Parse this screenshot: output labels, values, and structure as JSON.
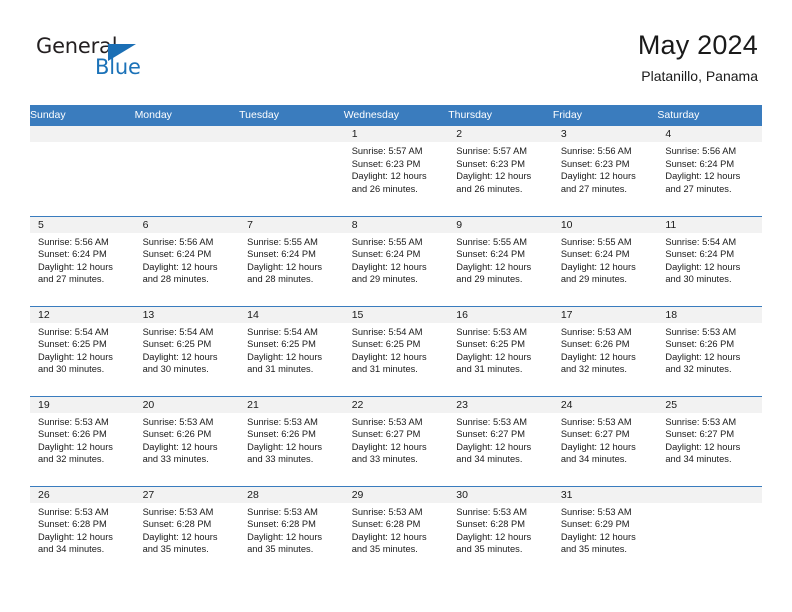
{
  "brand": {
    "name_part1": "General",
    "name_part2": "Blue",
    "logo_icon": "triangle-logo-icon"
  },
  "header": {
    "title": "May 2024",
    "location": "Platanillo, Panama"
  },
  "colors": {
    "header_blue": "#3a7cbe",
    "brand_blue": "#1b72b8",
    "day_strip_grey": "#f2f2f2",
    "text": "#1a1a1a"
  },
  "weekday_headers": [
    "Sunday",
    "Monday",
    "Tuesday",
    "Wednesday",
    "Thursday",
    "Friday",
    "Saturday"
  ],
  "weeks": [
    [
      {
        "day": "",
        "empty": true,
        "sunrise": "",
        "sunset": "",
        "daylight1": "",
        "daylight2": ""
      },
      {
        "day": "",
        "empty": true,
        "sunrise": "",
        "sunset": "",
        "daylight1": "",
        "daylight2": ""
      },
      {
        "day": "",
        "empty": true,
        "sunrise": "",
        "sunset": "",
        "daylight1": "",
        "daylight2": ""
      },
      {
        "day": "1",
        "empty": false,
        "sunrise": "Sunrise: 5:57 AM",
        "sunset": "Sunset: 6:23 PM",
        "daylight1": "Daylight: 12 hours",
        "daylight2": "and 26 minutes."
      },
      {
        "day": "2",
        "empty": false,
        "sunrise": "Sunrise: 5:57 AM",
        "sunset": "Sunset: 6:23 PM",
        "daylight1": "Daylight: 12 hours",
        "daylight2": "and 26 minutes."
      },
      {
        "day": "3",
        "empty": false,
        "sunrise": "Sunrise: 5:56 AM",
        "sunset": "Sunset: 6:23 PM",
        "daylight1": "Daylight: 12 hours",
        "daylight2": "and 27 minutes."
      },
      {
        "day": "4",
        "empty": false,
        "sunrise": "Sunrise: 5:56 AM",
        "sunset": "Sunset: 6:24 PM",
        "daylight1": "Daylight: 12 hours",
        "daylight2": "and 27 minutes."
      }
    ],
    [
      {
        "day": "5",
        "empty": false,
        "sunrise": "Sunrise: 5:56 AM",
        "sunset": "Sunset: 6:24 PM",
        "daylight1": "Daylight: 12 hours",
        "daylight2": "and 27 minutes."
      },
      {
        "day": "6",
        "empty": false,
        "sunrise": "Sunrise: 5:56 AM",
        "sunset": "Sunset: 6:24 PM",
        "daylight1": "Daylight: 12 hours",
        "daylight2": "and 28 minutes."
      },
      {
        "day": "7",
        "empty": false,
        "sunrise": "Sunrise: 5:55 AM",
        "sunset": "Sunset: 6:24 PM",
        "daylight1": "Daylight: 12 hours",
        "daylight2": "and 28 minutes."
      },
      {
        "day": "8",
        "empty": false,
        "sunrise": "Sunrise: 5:55 AM",
        "sunset": "Sunset: 6:24 PM",
        "daylight1": "Daylight: 12 hours",
        "daylight2": "and 29 minutes."
      },
      {
        "day": "9",
        "empty": false,
        "sunrise": "Sunrise: 5:55 AM",
        "sunset": "Sunset: 6:24 PM",
        "daylight1": "Daylight: 12 hours",
        "daylight2": "and 29 minutes."
      },
      {
        "day": "10",
        "empty": false,
        "sunrise": "Sunrise: 5:55 AM",
        "sunset": "Sunset: 6:24 PM",
        "daylight1": "Daylight: 12 hours",
        "daylight2": "and 29 minutes."
      },
      {
        "day": "11",
        "empty": false,
        "sunrise": "Sunrise: 5:54 AM",
        "sunset": "Sunset: 6:24 PM",
        "daylight1": "Daylight: 12 hours",
        "daylight2": "and 30 minutes."
      }
    ],
    [
      {
        "day": "12",
        "empty": false,
        "sunrise": "Sunrise: 5:54 AM",
        "sunset": "Sunset: 6:25 PM",
        "daylight1": "Daylight: 12 hours",
        "daylight2": "and 30 minutes."
      },
      {
        "day": "13",
        "empty": false,
        "sunrise": "Sunrise: 5:54 AM",
        "sunset": "Sunset: 6:25 PM",
        "daylight1": "Daylight: 12 hours",
        "daylight2": "and 30 minutes."
      },
      {
        "day": "14",
        "empty": false,
        "sunrise": "Sunrise: 5:54 AM",
        "sunset": "Sunset: 6:25 PM",
        "daylight1": "Daylight: 12 hours",
        "daylight2": "and 31 minutes."
      },
      {
        "day": "15",
        "empty": false,
        "sunrise": "Sunrise: 5:54 AM",
        "sunset": "Sunset: 6:25 PM",
        "daylight1": "Daylight: 12 hours",
        "daylight2": "and 31 minutes."
      },
      {
        "day": "16",
        "empty": false,
        "sunrise": "Sunrise: 5:53 AM",
        "sunset": "Sunset: 6:25 PM",
        "daylight1": "Daylight: 12 hours",
        "daylight2": "and 31 minutes."
      },
      {
        "day": "17",
        "empty": false,
        "sunrise": "Sunrise: 5:53 AM",
        "sunset": "Sunset: 6:26 PM",
        "daylight1": "Daylight: 12 hours",
        "daylight2": "and 32 minutes."
      },
      {
        "day": "18",
        "empty": false,
        "sunrise": "Sunrise: 5:53 AM",
        "sunset": "Sunset: 6:26 PM",
        "daylight1": "Daylight: 12 hours",
        "daylight2": "and 32 minutes."
      }
    ],
    [
      {
        "day": "19",
        "empty": false,
        "sunrise": "Sunrise: 5:53 AM",
        "sunset": "Sunset: 6:26 PM",
        "daylight1": "Daylight: 12 hours",
        "daylight2": "and 32 minutes."
      },
      {
        "day": "20",
        "empty": false,
        "sunrise": "Sunrise: 5:53 AM",
        "sunset": "Sunset: 6:26 PM",
        "daylight1": "Daylight: 12 hours",
        "daylight2": "and 33 minutes."
      },
      {
        "day": "21",
        "empty": false,
        "sunrise": "Sunrise: 5:53 AM",
        "sunset": "Sunset: 6:26 PM",
        "daylight1": "Daylight: 12 hours",
        "daylight2": "and 33 minutes."
      },
      {
        "day": "22",
        "empty": false,
        "sunrise": "Sunrise: 5:53 AM",
        "sunset": "Sunset: 6:27 PM",
        "daylight1": "Daylight: 12 hours",
        "daylight2": "and 33 minutes."
      },
      {
        "day": "23",
        "empty": false,
        "sunrise": "Sunrise: 5:53 AM",
        "sunset": "Sunset: 6:27 PM",
        "daylight1": "Daylight: 12 hours",
        "daylight2": "and 34 minutes."
      },
      {
        "day": "24",
        "empty": false,
        "sunrise": "Sunrise: 5:53 AM",
        "sunset": "Sunset: 6:27 PM",
        "daylight1": "Daylight: 12 hours",
        "daylight2": "and 34 minutes."
      },
      {
        "day": "25",
        "empty": false,
        "sunrise": "Sunrise: 5:53 AM",
        "sunset": "Sunset: 6:27 PM",
        "daylight1": "Daylight: 12 hours",
        "daylight2": "and 34 minutes."
      }
    ],
    [
      {
        "day": "26",
        "empty": false,
        "sunrise": "Sunrise: 5:53 AM",
        "sunset": "Sunset: 6:28 PM",
        "daylight1": "Daylight: 12 hours",
        "daylight2": "and 34 minutes."
      },
      {
        "day": "27",
        "empty": false,
        "sunrise": "Sunrise: 5:53 AM",
        "sunset": "Sunset: 6:28 PM",
        "daylight1": "Daylight: 12 hours",
        "daylight2": "and 35 minutes."
      },
      {
        "day": "28",
        "empty": false,
        "sunrise": "Sunrise: 5:53 AM",
        "sunset": "Sunset: 6:28 PM",
        "daylight1": "Daylight: 12 hours",
        "daylight2": "and 35 minutes."
      },
      {
        "day": "29",
        "empty": false,
        "sunrise": "Sunrise: 5:53 AM",
        "sunset": "Sunset: 6:28 PM",
        "daylight1": "Daylight: 12 hours",
        "daylight2": "and 35 minutes."
      },
      {
        "day": "30",
        "empty": false,
        "sunrise": "Sunrise: 5:53 AM",
        "sunset": "Sunset: 6:28 PM",
        "daylight1": "Daylight: 12 hours",
        "daylight2": "and 35 minutes."
      },
      {
        "day": "31",
        "empty": false,
        "sunrise": "Sunrise: 5:53 AM",
        "sunset": "Sunset: 6:29 PM",
        "daylight1": "Daylight: 12 hours",
        "daylight2": "and 35 minutes."
      },
      {
        "day": "",
        "empty": true,
        "sunrise": "",
        "sunset": "",
        "daylight1": "",
        "daylight2": ""
      }
    ]
  ]
}
